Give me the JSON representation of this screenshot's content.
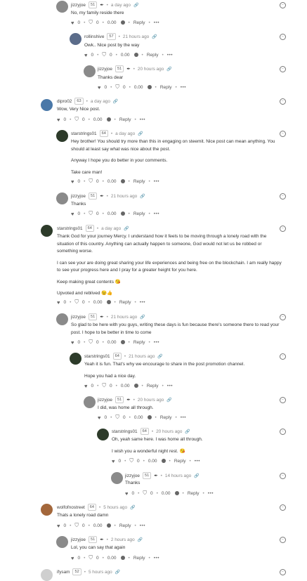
{
  "labels": {
    "reply": "Reply",
    "more": "•••",
    "zero": "0",
    "money": "0.00"
  },
  "comments": [
    {
      "user": "jizzyjoe",
      "rep": "51",
      "time": "a day ago",
      "text": [
        "No, my family reside there"
      ]
    },
    {
      "user": "rollinshive",
      "rep": "57",
      "time": "21 hours ago",
      "text": [
        "Owk.. Nice post by the way"
      ]
    },
    {
      "user": "jizzyjoe",
      "rep": "51",
      "time": "20 hours ago",
      "text": [
        "Thanks dear"
      ]
    },
    {
      "user": "dipro02",
      "rep": "63",
      "time": "a day ago",
      "text": [
        "Wow, Very Nice post."
      ]
    },
    {
      "user": "starstrings01",
      "rep": "64",
      "time": "a day ago",
      "text": [
        "Hey brother! You should try more than this in engaging on steemit. Nice post can mean anything. You should at least say what was nice about the post.",
        "Anyway I hope you do better in your comments.",
        "Take care man!"
      ]
    },
    {
      "user": "jizzyjoe",
      "rep": "51",
      "time": "21 hours ago",
      "text": [
        "Thanks"
      ]
    },
    {
      "user": "starstrings01",
      "rep": "64",
      "time": "a day ago",
      "text": [
        "Thank God for your journey Mercy. I understand how it feels to be moving through a lonely road with the situation of this country. Anything can actually happen to someone, God would not let us be robbed or something worse.",
        "I can see your are doing great sharing your life experiences and being free on the blockchain. I am really happy to see your progress here and I pray for a greater height for you here.",
        "Keep making great contents 😘",
        "Upvoted and reblived 😉👍"
      ]
    },
    {
      "user": "jizzyjoe",
      "rep": "51",
      "time": "21 hours ago",
      "text": [
        "So glad to be here with you guys, writing these days is fun because there's someone there to read your post. I hope to be better in time to come"
      ]
    },
    {
      "user": "starstrings01",
      "rep": "64",
      "time": "21 hours ago",
      "text": [
        "Yeah it is fun. That's why we encourage to share in the post promotion channel.",
        "Hope you had a nice day."
      ]
    },
    {
      "user": "jizzyjoe",
      "rep": "51",
      "time": "20 hours ago",
      "text": [
        "I did, was home all through."
      ]
    },
    {
      "user": "starstrings01",
      "rep": "64",
      "time": "20 hours ago",
      "text": [
        "Oh, yeah same here. I was home all through.",
        "I wish you a wonderful night rest. 😘"
      ]
    },
    {
      "user": "jizzyjoe",
      "rep": "51",
      "time": "14 hours ago",
      "text": [
        "Thanks"
      ]
    },
    {
      "user": "wolfofnostreet",
      "rep": "64",
      "time": "5 hours ago",
      "text": [
        "Thats a lonely road damn"
      ]
    },
    {
      "user": "jizzyjoe",
      "rep": "51",
      "time": "2 hours ago",
      "text": [
        "Lol, you can say that again"
      ]
    },
    {
      "user": "ifysam",
      "rep": "52",
      "time": "5 hours ago",
      "text": []
    }
  ]
}
